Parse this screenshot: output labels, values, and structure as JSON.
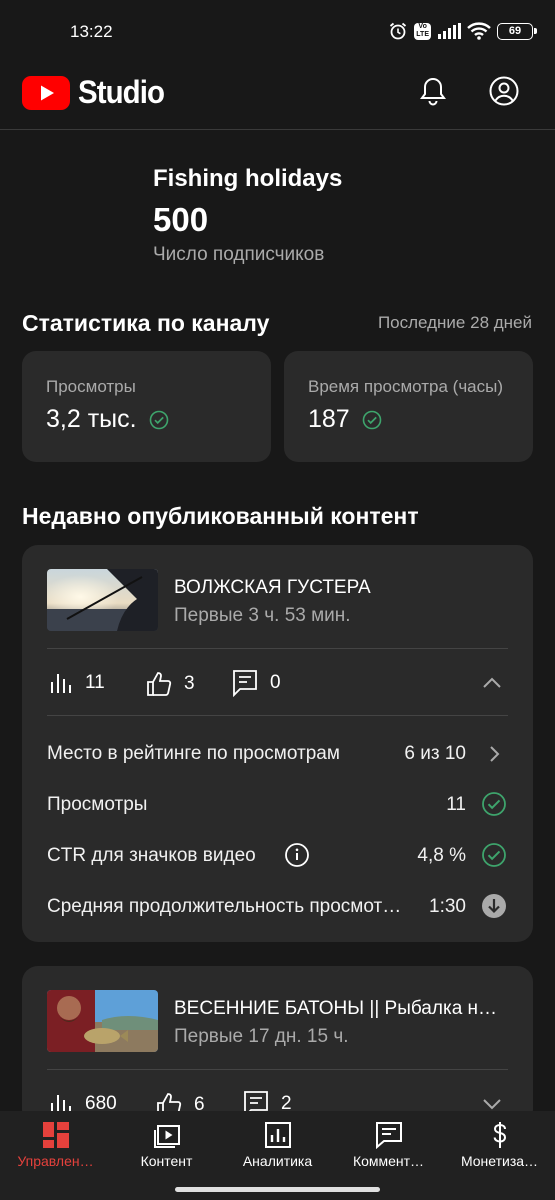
{
  "status_bar": {
    "time": "13:22",
    "network_badge_top": "Vo",
    "network_badge_bottom": "LTE",
    "battery": "69",
    "icons": [
      "alarm-icon",
      "signal-icon",
      "wifi-icon",
      "battery-icon"
    ]
  },
  "header": {
    "app_name": "Studio",
    "icons": [
      "youtube-logo-icon",
      "bell-icon",
      "account-icon"
    ],
    "brand_color": "#ff0000"
  },
  "channel": {
    "name": "Fishing holidays",
    "subscribers": "500",
    "subscribers_label": "Число подписчиков"
  },
  "stats": {
    "title": "Статистика по каналу",
    "period": "Последние 28 дней",
    "cards": [
      {
        "label": "Просмотры",
        "value": "3,2 тыс.",
        "icon": "check-circle-icon"
      },
      {
        "label": "Время просмотра (часы)",
        "value": "187",
        "icon": "check-circle-icon"
      }
    ]
  },
  "recent": {
    "title": "Недавно опубликованный контент",
    "videos": [
      {
        "title": "ВОЛЖСКАЯ ГУСТЕРА",
        "subtitle": "Первые 3 ч. 53 мин.",
        "views": "11",
        "likes": "3",
        "comments": "0",
        "expanded": true,
        "details": [
          {
            "label": "Место в рейтинге по просмотрам",
            "value": "6 из 10",
            "icon": "chevron-right-icon"
          },
          {
            "label": "Просмотры",
            "value": "11",
            "icon": "check-circle-icon"
          },
          {
            "label": "CTR для значков видео",
            "value": "4,8 %",
            "icon": "check-circle-icon",
            "info_icon": "info-icon"
          },
          {
            "label": "Средняя продолжительность просмот…",
            "value": "1:30",
            "icon": "arrow-down-circle-icon"
          }
        ]
      },
      {
        "title": "ВЕСЕННИЕ БАТОНЫ || Рыбалка н…",
        "subtitle": "Первые 17 дн. 15 ч.",
        "views": "680",
        "likes": "6",
        "comments": "2",
        "expanded": false
      }
    ]
  },
  "bottom_nav": {
    "active_color": "#e5413c",
    "items": [
      {
        "label": "Управлен…",
        "icon": "dashboard-icon",
        "active": true
      },
      {
        "label": "Контент",
        "icon": "content-icon",
        "active": false
      },
      {
        "label": "Аналитика",
        "icon": "analytics-icon",
        "active": false
      },
      {
        "label": "Коммент…",
        "icon": "comments-icon",
        "active": false
      },
      {
        "label": "Монетиза…",
        "icon": "dollar-icon",
        "active": false
      }
    ]
  }
}
